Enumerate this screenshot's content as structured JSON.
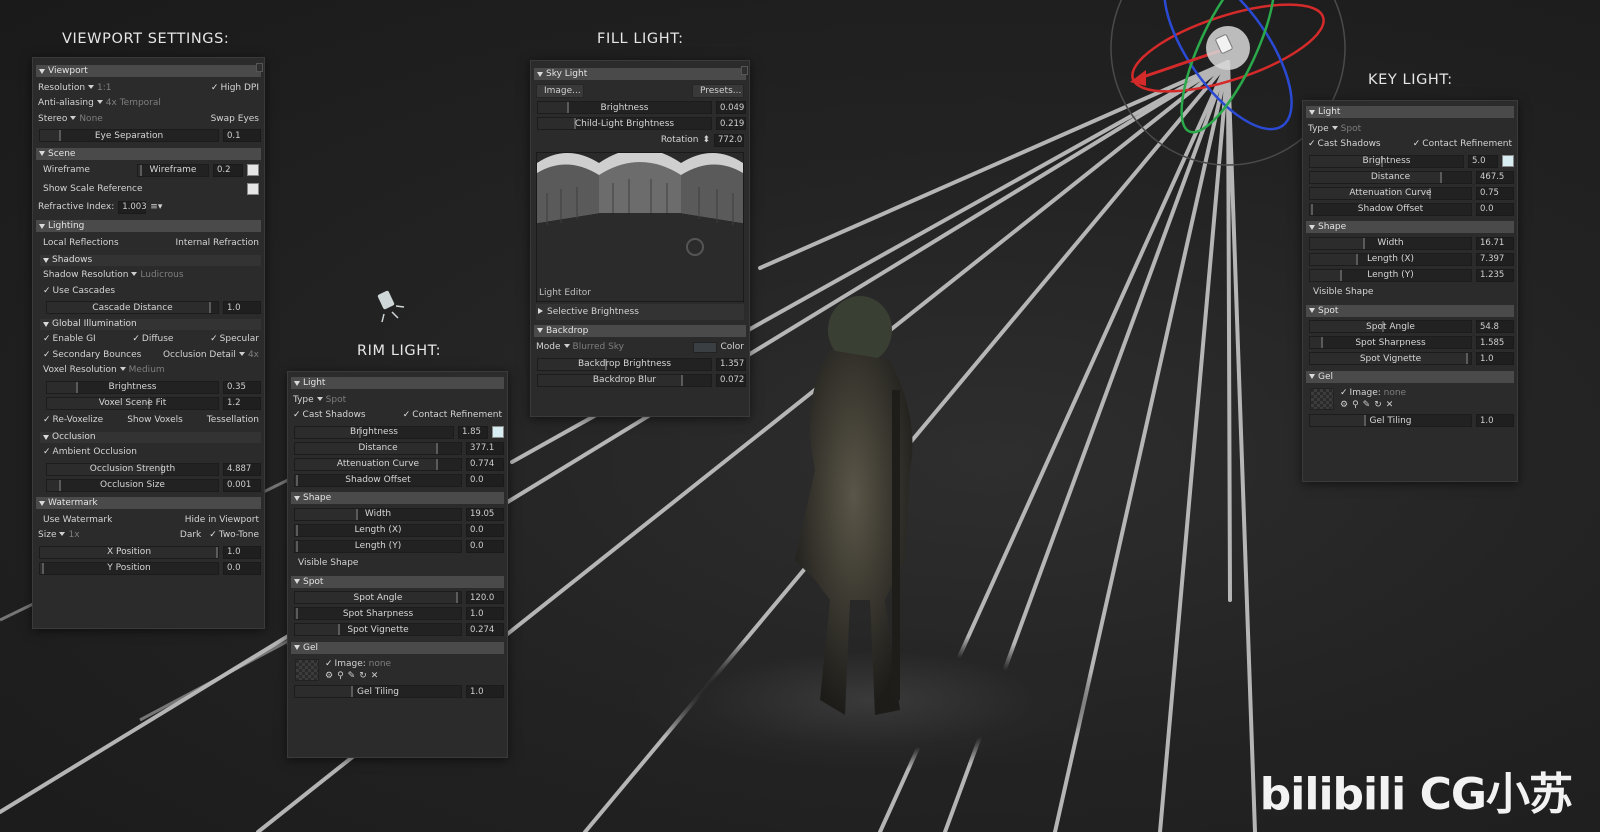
{
  "viewport_settings": {
    "title": "VIEWPORT SETTINGS:",
    "viewport": {
      "header": "Viewport",
      "resolution_label": "Resolution",
      "resolution_value": "1:1",
      "high_dpi_label": "High DPI",
      "antialiasing_label": "Anti-aliasing",
      "antialiasing_value": "4x Temporal",
      "stereo_label": "Stereo",
      "stereo_value": "None",
      "swap_eyes_label": "Swap Eyes",
      "eye_separation_label": "Eye Separation",
      "eye_separation_value": "0.1"
    },
    "scene": {
      "header": "Scene",
      "wireframe_label": "Wireframe",
      "wireframe_slider_label": "Wireframe",
      "wireframe_value": "0.2",
      "show_scale_label": "Show Scale Reference",
      "refractive_label": "Refractive Index:",
      "refractive_value": "1.003"
    },
    "lighting": {
      "header": "Lighting",
      "local_reflections_label": "Local Reflections",
      "internal_refraction_label": "Internal Refraction",
      "shadows_header": "Shadows",
      "shadow_resolution_label": "Shadow Resolution",
      "shadow_resolution_value": "Ludicrous",
      "use_cascades_label": "Use Cascades",
      "cascade_distance_label": "Cascade Distance",
      "cascade_distance_value": "1.0",
      "gi_header": "Global Illumination",
      "enable_gi_label": "Enable GI",
      "diffuse_label": "Diffuse",
      "specular_label": "Specular",
      "secondary_bounces_label": "Secondary Bounces",
      "occlusion_detail_label": "Occlusion Detail",
      "occlusion_detail_value": "4x",
      "voxel_resolution_label": "Voxel Resolution",
      "voxel_resolution_value": "Medium",
      "brightness_label": "Brightness",
      "brightness_value": "0.35",
      "voxel_scene_fit_label": "Voxel Scene Fit",
      "voxel_scene_fit_value": "1.2",
      "revoxelize_label": "Re-Voxelize",
      "show_voxels_label": "Show Voxels",
      "tessellation_label": "Tessellation",
      "occlusion_header": "Occlusion",
      "ambient_occlusion_label": "Ambient Occlusion",
      "occlusion_strength_label": "Occlusion Strength",
      "occlusion_strength_value": "4.887",
      "occlusion_size_label": "Occlusion Size",
      "occlusion_size_value": "0.001"
    },
    "watermark": {
      "header": "Watermark",
      "use_watermark_label": "Use Watermark",
      "hide_in_viewport_label": "Hide in Viewport",
      "size_label": "Size",
      "size_value": "1x",
      "dark_label": "Dark",
      "two_tone_label": "Two-Tone",
      "x_position_label": "X Position",
      "x_position_value": "1.0",
      "y_position_label": "Y Position",
      "y_position_value": "0.0"
    }
  },
  "fill_light": {
    "title": "FILL LIGHT:",
    "sky_light_header": "Sky Light",
    "image_button": "Image...",
    "presets_button": "Presets...",
    "brightness_label": "Brightness",
    "brightness_value": "0.049",
    "child_light_label": "Child-Light Brightness",
    "child_light_value": "0.219",
    "rotation_label": "Rotation",
    "rotation_value": "772.0",
    "light_editor_label": "Light Editor",
    "selective_brightness_label": "Selective Brightness",
    "backdrop_header": "Backdrop",
    "mode_label": "Mode",
    "mode_value": "Blurred Sky",
    "color_label": "Color",
    "backdrop_brightness_label": "Backdrop Brightness",
    "backdrop_brightness_value": "1.357",
    "backdrop_blur_label": "Backdrop Blur",
    "backdrop_blur_value": "0.072"
  },
  "rim_light": {
    "title": "RIM LIGHT:",
    "light_header": "Light",
    "type_label": "Type",
    "type_value": "Spot",
    "cast_shadows_label": "Cast Shadows",
    "contact_refinement_label": "Contact Refinement",
    "brightness_label": "Brightness",
    "brightness_value": "1.85",
    "distance_label": "Distance",
    "distance_value": "377.1",
    "attenuation_label": "Attenuation Curve",
    "attenuation_value": "0.774",
    "shadow_offset_label": "Shadow Offset",
    "shadow_offset_value": "0.0",
    "shape_header": "Shape",
    "width_label": "Width",
    "width_value": "19.05",
    "length_x_label": "Length (X)",
    "length_x_value": "0.0",
    "length_y_label": "Length (Y)",
    "length_y_value": "0.0",
    "visible_shape_label": "Visible Shape",
    "spot_header": "Spot",
    "spot_angle_label": "Spot Angle",
    "spot_angle_value": "120.0",
    "spot_sharpness_label": "Spot Sharpness",
    "spot_sharpness_value": "1.0",
    "spot_vignette_label": "Spot Vignette",
    "spot_vignette_value": "0.274",
    "gel_header": "Gel",
    "image_label": "Image:",
    "image_value": "none",
    "gel_tiling_label": "Gel Tiling",
    "gel_tiling_value": "1.0"
  },
  "key_light": {
    "title": "KEY LIGHT:",
    "light_header": "Light",
    "type_label": "Type",
    "type_value": "Spot",
    "cast_shadows_label": "Cast Shadows",
    "contact_refinement_label": "Contact Refinement",
    "brightness_label": "Brightness",
    "brightness_value": "5.0",
    "distance_label": "Distance",
    "distance_value": "467.5",
    "attenuation_label": "Attenuation Curve",
    "attenuation_value": "0.75",
    "shadow_offset_label": "Shadow Offset",
    "shadow_offset_value": "0.0",
    "shape_header": "Shape",
    "width_label": "Width",
    "width_value": "16.71",
    "length_x_label": "Length (X)",
    "length_x_value": "7.397",
    "length_y_label": "Length (Y)",
    "length_y_value": "1.235",
    "visible_shape_label": "Visible Shape",
    "spot_header": "Spot",
    "spot_angle_label": "Spot Angle",
    "spot_angle_value": "54.8",
    "spot_sharpness_label": "Spot Sharpness",
    "spot_sharpness_value": "1.585",
    "spot_vignette_label": "Spot Vignette",
    "spot_vignette_value": "1.0",
    "gel_header": "Gel",
    "image_label": "Image:",
    "image_value": "none",
    "gel_tiling_label": "Gel Tiling",
    "gel_tiling_value": "1.0"
  },
  "watermark_logo": "bilibili CG小苏",
  "icons": [
    "gear-icon",
    "magnifier-icon",
    "eyedropper-icon",
    "refresh-icon",
    "close-icon",
    "spotlight-icon",
    "dropdown-arrow-icon",
    "checkmark-icon",
    "rotation-stepper-icon"
  ],
  "colors": {
    "swatch_white": "#e6e6e6",
    "swatch_light_blue": "#d8eef2",
    "background": "#232323",
    "gizmo_red": "#d42a2a",
    "gizmo_green": "#2aa84a",
    "gizmo_blue": "#2a4ad4"
  }
}
